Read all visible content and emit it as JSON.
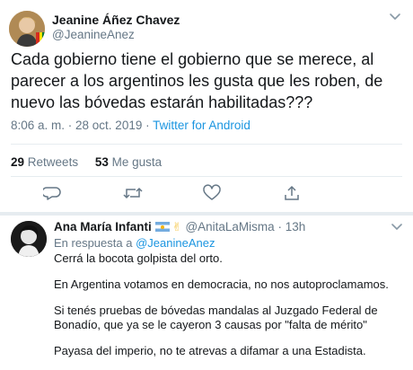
{
  "main_tweet": {
    "author_name": "Jeanine Áñez Chavez",
    "author_handle": "@JeanineAnez",
    "text": "Cada gobierno tiene el gobierno que se merece, al parecer a los argentinos les gusta que les roben, de nuevo las bóvedas estarán habilitadas???",
    "timestamp": "8:06 a. m. · 28 oct. 2019 ·",
    "source": "Twitter for Android",
    "retweets_count": "29",
    "retweets_label": "Retweets",
    "likes_count": "53",
    "likes_label": "Me gusta"
  },
  "reply": {
    "author_name": "Ana María Infanti",
    "author_handle": "@AnitaLaMisma",
    "time": "13h",
    "in_reply_to_label": "En respuesta a",
    "in_reply_to_handle": "@JeanineAnez",
    "paragraphs": [
      "Cerrá la bocota golpista del orto.",
      "En Argentina votamos en democracia, no nos autoproclamamos.",
      "Si tenés pruebas de bóvedas mandalas al Juzgado Federal de Bonadío, que ya se le cayeron 3 causas por \"falta de mérito\"",
      "Payasa del imperio, no te atrevas a difamar a una Estadista."
    ]
  },
  "icons": {
    "reply": "reply-icon",
    "retweet": "retweet-icon",
    "like": "heart-icon",
    "share": "share-icon",
    "caret": "chevron-down-icon"
  },
  "colors": {
    "link": "#1b95e0",
    "secondary_text": "#657786",
    "divider": "#e6ecf0"
  }
}
